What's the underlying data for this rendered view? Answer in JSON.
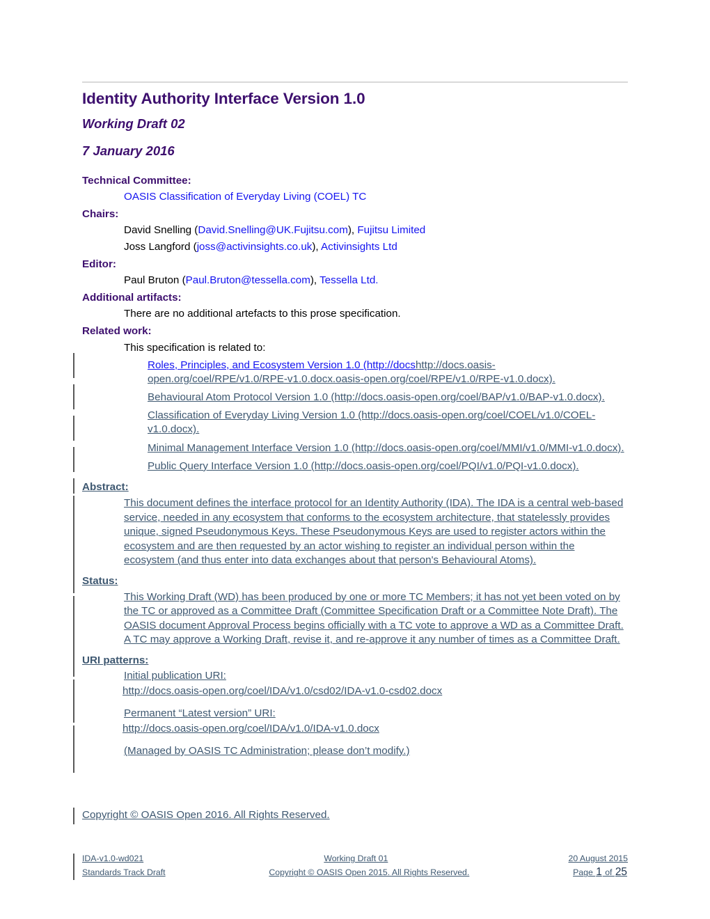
{
  "document": {
    "title": "Identity Authority Interface Version 1.0",
    "subtitle": "Working Draft 02",
    "date": "7 January 2016"
  },
  "colors": {
    "heading_purple": "#3d0f6e",
    "hyperlink_blue": "#1414f0",
    "inserted_text": "#3e5871",
    "change_bar": "#595959",
    "top_rule": "#d9d9d9"
  },
  "metadata": {
    "technical_committee": {
      "label": "Technical Committee:",
      "value": "OASIS Classification of Everyday Living (COEL) TC"
    },
    "chairs": {
      "label": "Chairs:",
      "entries": [
        {
          "name": "David Snelling (",
          "email": "David.Snelling@UK.Fujitsu.com",
          "sep": "), ",
          "org": "Fujitsu Limited"
        },
        {
          "name": "Joss Langford (",
          "email": "joss@activinsights.co.uk",
          "sep": "), ",
          "org": "Activinsights Ltd"
        }
      ]
    },
    "editor": {
      "label": "Editor:",
      "entries": [
        {
          "name": "Paul Bruton (",
          "email": "Paul.Bruton@tessella.com",
          "sep": "), ",
          "org": "Tessella Ltd."
        }
      ]
    },
    "additional_artifacts": {
      "label": "Additional artifacts:",
      "value": "There are no additional artefacts to this prose specification."
    },
    "related_work": {
      "label": "Related work:",
      "intro": "This specification is related to:",
      "items": [
        {
          "lead": "Roles, Principles, and Ecosystem Version 1.0 (http://docs",
          "rest": "http://docs.oasis-open.org/coel/RPE/v1.0/RPE-v1.0.docx.oasis-open.org/coel/RPE/v1.0/RPE-v1.0.docx). "
        },
        {
          "lead": "",
          "rest": "Behavioural Atom Protocol Version 1.0 (http://docs.oasis-open.org/coel/BAP/v1.0/BAP-v1.0.docx). "
        },
        {
          "lead": "",
          "rest": "Classification of Everyday Living Version 1.0 (http://docs.oasis-open.org/coel/COEL/v1.0/COEL-v1.0.docx). "
        },
        {
          "lead": "",
          "rest": "Minimal Management Interface Version 1.0 (http://docs.oasis-open.org/coel/MMI/v1.0/MMI-v1.0.docx). "
        },
        {
          "lead": "",
          "rest": "Public Query Interface Version 1.0 (http://docs.oasis-open.org/coel/PQI/v1.0/PQI-v1.0.docx). "
        }
      ]
    },
    "abstract": {
      "label": "Abstract:",
      "value": "This document defines the interface protocol for an Identity Authority (IDA). The IDA is a central web-based service, needed in any ecosystem that conforms to the ecosystem architecture, that statelessly provides unique, signed Pseudonymous Keys. These Pseudonymous Keys are used to register actors within the ecosystem and are then requested by an actor wishing to register an individual person within the ecosystem (and thus enter into data exchanges about that person's Behavioural Atoms)."
    },
    "status": {
      "label": "Status:",
      "value": "This Working Draft (WD) has been produced by one or more TC Members; it has not yet been voted on by the TC or approved as a Committee Draft (Committee Specification Draft or a Committee Note Draft). The OASIS document Approval Process begins officially with a TC vote to approve a WD as a Committee Draft. A TC may approve a Working Draft, revise it, and re-approve it any number of times as a Committee Draft."
    },
    "uri_patterns": {
      "label": "URI patterns:",
      "initial_publication_label": "Initial publication URI:",
      "initial_publication_uri": "http://docs.oasis-open.org/coel/IDA/v1.0/csd02/IDA-v1.0-csd02.docx ",
      "permanent_label": "Permanent “Latest version” URI:",
      "permanent_uri": "http://docs.oasis-open.org/coel/IDA/v1.0/IDA-v1.0.docx ",
      "note": "(Managed by OASIS TC Administration; please don’t modify.)"
    }
  },
  "copyright": "Copyright © OASIS Open 2016. All Rights Reserved.",
  "footer": {
    "row1": {
      "left": "IDA-v1.0-wd021",
      "center": "Working Draft 01",
      "right": "20 August 2015"
    },
    "row2": {
      "left": "Standards Track Draft",
      "center": "Copyright © OASIS Open 2015. All Rights Reserved.",
      "page_word": "Page ",
      "page_number": "1",
      "of_word": " of ",
      "page_total": "25"
    }
  }
}
